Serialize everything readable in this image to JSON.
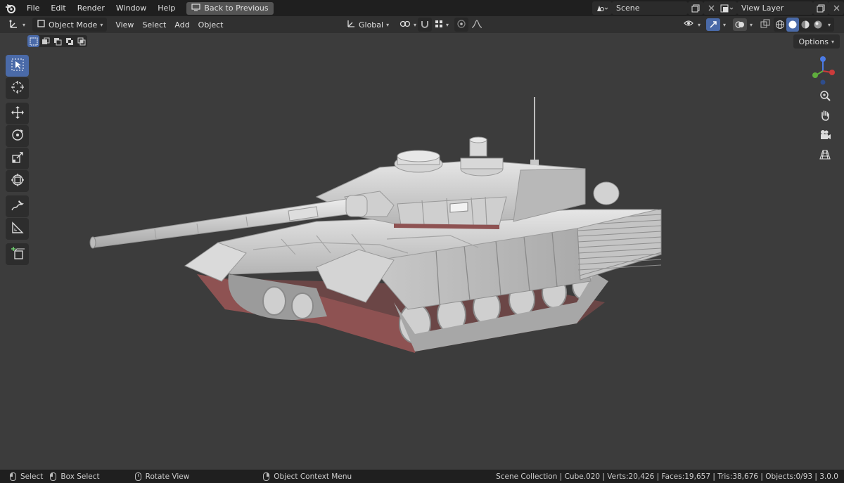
{
  "topbar": {
    "menus": [
      "File",
      "Edit",
      "Render",
      "Window",
      "Help"
    ],
    "back_label": "Back to Previous",
    "scene_name": "Scene",
    "view_layer": "View Layer"
  },
  "header": {
    "mode": "Object Mode",
    "menus": [
      "View",
      "Select",
      "Add",
      "Object"
    ],
    "orientation": "Global"
  },
  "viewport": {
    "options_label": "Options"
  },
  "statusbar": {
    "select": "Select",
    "box_select": "Box Select",
    "rotate_view": "Rotate View",
    "context_menu": "Object Context Menu",
    "stats": "Scene Collection | Cube.020 | Verts:20,426 | Faces:19,657 | Tris:38,676 | Objects:0/93 | 3.0.0"
  },
  "colors": {
    "accent": "#4a6aa8",
    "background": "#3c3c3c",
    "bars": "#1f1f1f"
  }
}
